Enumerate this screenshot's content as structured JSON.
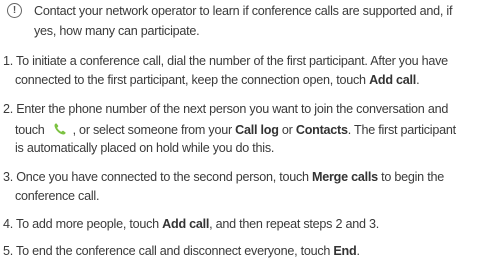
{
  "note": {
    "icon": "exclamation-note-icon",
    "icon_glyph": "!",
    "line1": "Contact your network operator to learn if conference calls are supported and, if",
    "line2": "yes, how many can participate."
  },
  "steps": {
    "s1": {
      "l1": "1. To initiate a conference call, dial the number of the first participant. After you have",
      "l2_pre": "connected to the first participant, keep the connection open, touch ",
      "l2_bold": "Add call",
      "l2_post": "."
    },
    "s2": {
      "l1": "2. Enter the phone number of the next person you want to join the conversation and",
      "l2_pre": "touch",
      "icon": "green-phone-icon",
      "l2_mid": ", or select someone from your ",
      "l2_bold1": "Call log",
      "l2_or": " or ",
      "l2_bold2": "Contacts",
      "l2_post": ". The first participant",
      "l3": "is automatically placed on hold while you do this."
    },
    "s3": {
      "l1_pre": "3. Once you have connected to the second person, touch ",
      "l1_bold": "Merge calls",
      "l1_post": " to begin the",
      "l2": "conference call."
    },
    "s4": {
      "pre": "4. To add more people, touch ",
      "bold": "Add call",
      "post": ", and then repeat steps 2 and 3."
    },
    "s5": {
      "pre": "5. To end the conference call and disconnect everyone, touch ",
      "bold": "End",
      "post": "."
    }
  },
  "colors": {
    "text": "#3a3a3a",
    "phone_icon": "#7cc242"
  }
}
